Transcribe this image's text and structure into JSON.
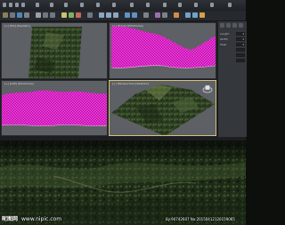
{
  "watermark": {
    "logo_text": "昵图网",
    "site": "www.nipic.com",
    "author_id": "By:90742607 No:20150412120159065"
  },
  "viewports": [
    {
      "label": "[+] [Top] [Realistic]"
    },
    {
      "label": "[+] [Front] [Wireframe]"
    },
    {
      "label": "[+] [Left] [Wireframe]"
    },
    {
      "label": "[+] [Perspective] [Realistic]"
    }
  ],
  "command_panel": {
    "rows": [
      {
        "label": "Length",
        "value": "1"
      },
      {
        "label": "Width",
        "value": "1"
      },
      {
        "label": "Segs",
        "value": "1"
      },
      {
        "label": "",
        "value": ""
      },
      {
        "label": "",
        "value": ""
      },
      {
        "label": "",
        "value": ""
      }
    ]
  },
  "colors": {
    "wireframe": "#e018c8",
    "viewport_bg": "#5d6064",
    "terrain_dark": "#1c2a18",
    "terrain_mid": "#3f5a2e",
    "terrain_light": "#7a8a55",
    "active_border": "#d4c27a"
  }
}
